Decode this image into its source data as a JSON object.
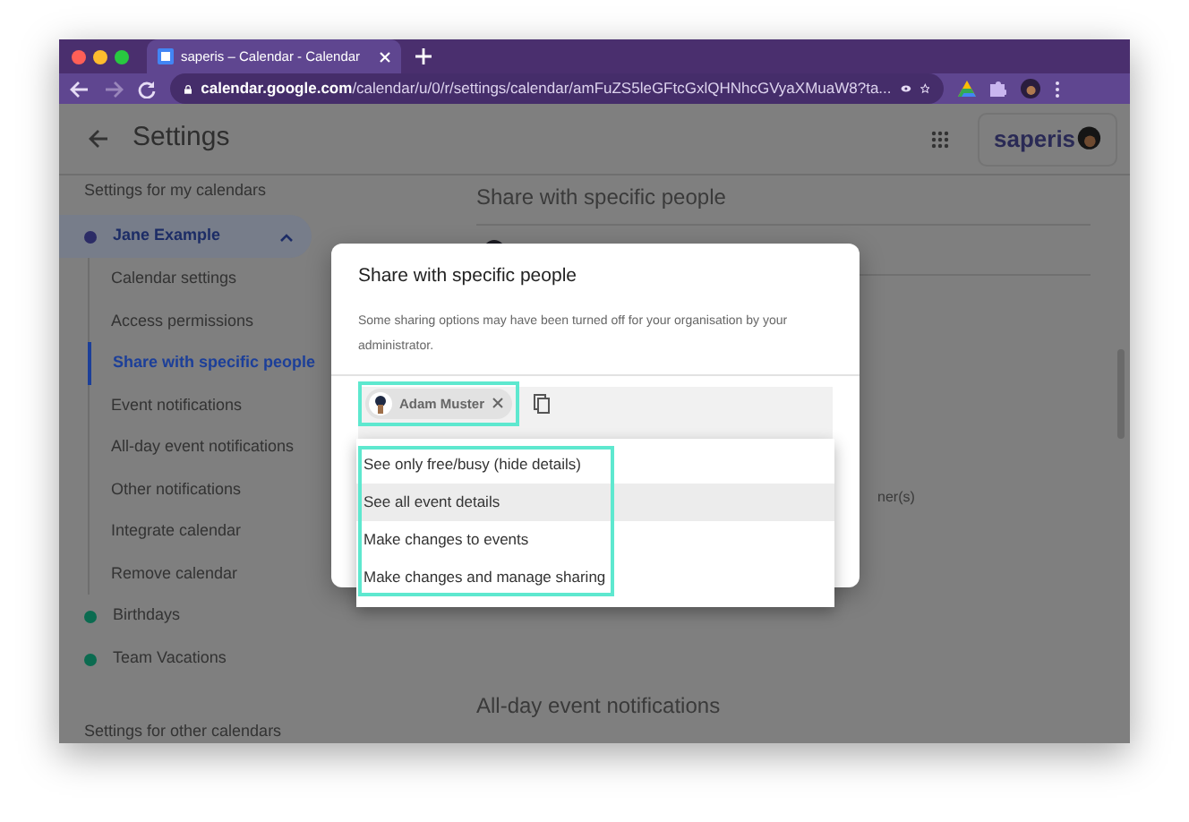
{
  "browser": {
    "tab_title": "saperis – Calendar - Calendar",
    "url_host": "calendar.google.com",
    "url_path": "/calendar/u/0/r/settings/calendar/amFuZS5leGFtcGxlQHNhcGVyaXMuaW8?ta..."
  },
  "header": {
    "title": "Settings",
    "brand": "saperis"
  },
  "sidebar": {
    "heading": "Settings for my calendars",
    "calendars": [
      {
        "name": "Jane Example",
        "color": "#2c2c66",
        "selected": true,
        "expanded": true,
        "children": [
          {
            "label": "Calendar settings",
            "selected": false
          },
          {
            "label": "Access permissions",
            "selected": false
          },
          {
            "label": "Share with specific people",
            "selected": true
          },
          {
            "label": "Event notifications",
            "selected": false
          },
          {
            "label": "All-day event notifications",
            "selected": false
          },
          {
            "label": "Other notifications",
            "selected": false
          },
          {
            "label": "Integrate calendar",
            "selected": false
          },
          {
            "label": "Remove calendar",
            "selected": false
          }
        ]
      },
      {
        "name": "Birthdays",
        "color": "#0b6b50",
        "selected": false
      },
      {
        "name": "Team Vacations",
        "color": "#0b6b50",
        "selected": false
      }
    ],
    "footer": "Settings for other calendars"
  },
  "content": {
    "heading": "Share with specific people",
    "fragment": "ner(s)",
    "next_heading": "All-day event notifications"
  },
  "dialog": {
    "title": "Share with specific people",
    "note": "Some sharing options may have been turned off for your organisation by your administrator.",
    "person": {
      "name": "Adam Muster",
      "highlighted": true
    },
    "permission_menu": {
      "highlighted": true,
      "options": [
        {
          "label": "See only free/busy (hide details)",
          "selected": false
        },
        {
          "label": "See all event details",
          "selected": true
        },
        {
          "label": "Make changes to events",
          "selected": false
        },
        {
          "label": "Make changes and manage sharing",
          "selected": false
        }
      ]
    }
  }
}
